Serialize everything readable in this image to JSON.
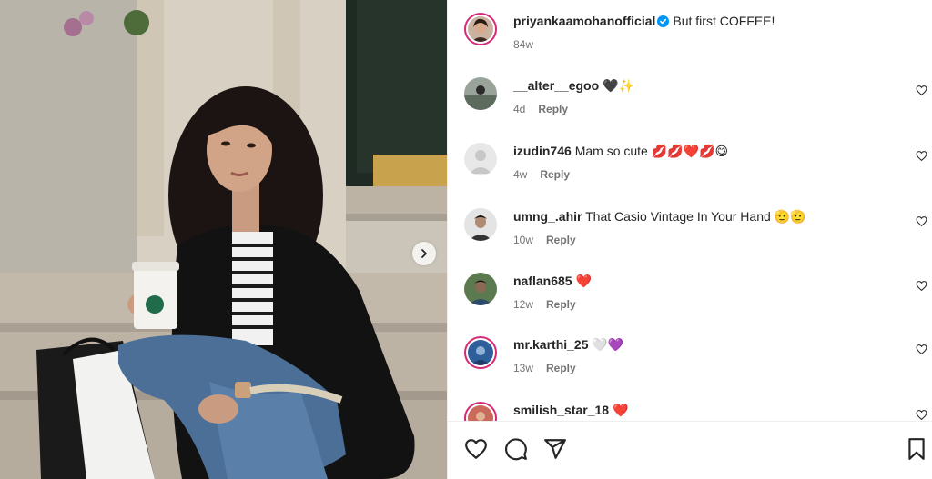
{
  "post": {
    "author": "priyankaamohanofficial",
    "caption": "But first COFFEE!",
    "age": "84w",
    "photo_alt": "woman seated on steps with a coffee cup"
  },
  "comments": [
    {
      "user": "__alter__egoo",
      "text": "🖤✨",
      "age": "4d",
      "reply": "Reply"
    },
    {
      "user": "izudin746",
      "text": "Mam so cute 💋💋❤️💋😋",
      "age": "4w",
      "reply": "Reply"
    },
    {
      "user": "umng_.ahir",
      "text": "That Casio Vintage In Your Hand 🫡🫡",
      "age": "10w",
      "reply": "Reply"
    },
    {
      "user": "naflan685",
      "text": "❤️",
      "age": "12w",
      "reply": "Reply"
    },
    {
      "user": "mr.karthi_25",
      "text": "🤍💜",
      "age": "13w",
      "reply": "Reply"
    },
    {
      "user": "smilish_star_18",
      "text": "❤️",
      "age": "",
      "reply": ""
    }
  ],
  "colors": {
    "verified": "#0095f6",
    "story_ring": "#d62976",
    "muted": "#737373"
  },
  "icons": {
    "like": "heart-icon",
    "comment": "comment-icon",
    "share": "send-icon",
    "save": "bookmark-icon",
    "next": "chevron-right-icon"
  }
}
